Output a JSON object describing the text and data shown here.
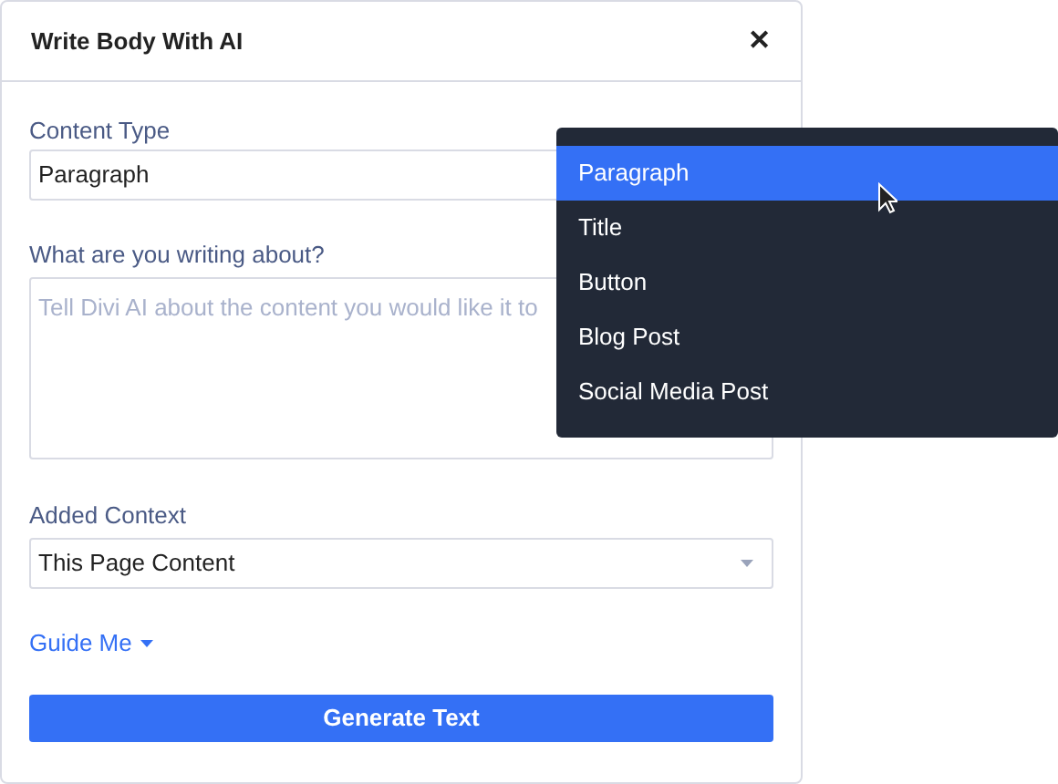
{
  "dialog": {
    "title": "Write Body With AI",
    "close": "✕"
  },
  "content_type": {
    "label": "Content Type",
    "value": "Paragraph"
  },
  "prompt": {
    "label": "What are you writing about?",
    "placeholder": "Tell Divi AI about the content you would like it to"
  },
  "added_context": {
    "label": "Added Context",
    "value": "This Page Content"
  },
  "guide_me": "Guide Me",
  "generate_button": "Generate Text",
  "dropdown": {
    "items": [
      {
        "label": "Paragraph",
        "selected": true
      },
      {
        "label": "Title",
        "selected": false
      },
      {
        "label": "Button",
        "selected": false
      },
      {
        "label": "Blog Post",
        "selected": false
      },
      {
        "label": "Social Media Post",
        "selected": false
      }
    ]
  }
}
